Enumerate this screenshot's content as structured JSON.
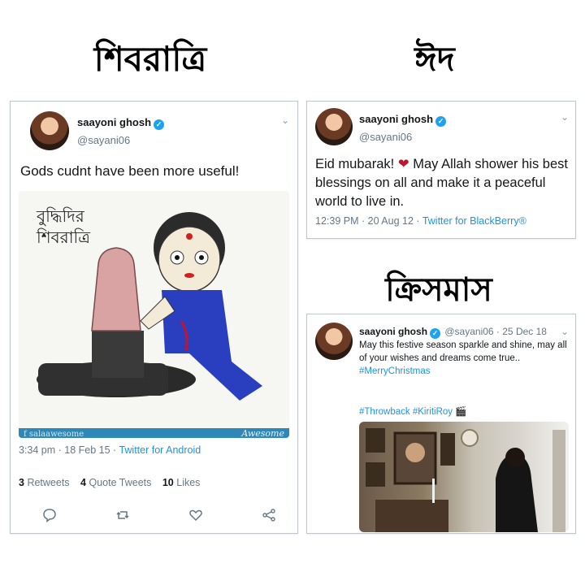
{
  "headings": {
    "left": "শিবরাত্রি",
    "right_top": "ঈদ",
    "right_bottom": "ক্রিসমাস"
  },
  "tweet1": {
    "name": "saayoni ghosh",
    "handle": "@sayani06",
    "text": "Gods cudnt have been more useful!",
    "image_text_line1": "বুদ্ধিদির",
    "image_text_line2": "শিবরাত্রি",
    "watermark_left": "salaawesome",
    "watermark_right": "Awesome",
    "time": "3:34 pm · 18 Feb 15 · ",
    "source": "Twitter for Android",
    "retweets_count": "3",
    "retweets_label": "Retweets",
    "quotes_count": "4",
    "quotes_label": "Quote Tweets",
    "likes_count": "10",
    "likes_label": "Likes",
    "icons": [
      "reply-icon",
      "retweet-icon",
      "like-icon",
      "share-icon"
    ]
  },
  "tweet2": {
    "name": "saayoni ghosh",
    "handle": "@sayani06",
    "text_before_heart": "Eid mubarak!",
    "text_after_heart": "May Allah shower his best blessings on all and make it a peaceful world to live in.",
    "time": "12:39 PM · 20 Aug 12 · ",
    "source": "Twitter for BlackBerry®"
  },
  "tweet3": {
    "name": "saayoni ghosh",
    "handle": "@sayani06 · 25 Dec 18",
    "text": "May this festive season sparkle and shine, may all of your wishes and dreams come true..",
    "hashtag1": "#MerryChristmas",
    "hashtags2": "#Throwback #KiritiRoy"
  },
  "colors": {
    "link": "#1b95e0",
    "verified": "#1da1f2",
    "heart": "#c0152f"
  }
}
